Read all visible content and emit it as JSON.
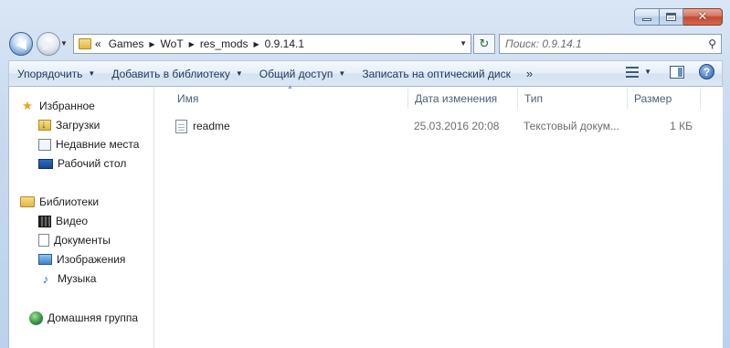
{
  "window": {
    "caption": {
      "minimize_icon": "minimize-icon",
      "maximize_icon": "maximize-icon",
      "close_icon": "close-icon",
      "close_glyph": "✕"
    }
  },
  "navigation": {
    "back_glyph": "◀",
    "forward_glyph": "▶",
    "breadcrumb_overflow": "«",
    "breadcrumb": [
      "Games",
      "WoT",
      "res_mods",
      "0.9.14.1"
    ],
    "breadcrumb_separator": "▶",
    "refresh_glyph": "↻",
    "search_placeholder": "Поиск: 0.9.14.1"
  },
  "commands": [
    {
      "label": "Упорядочить",
      "has_dropdown": true
    },
    {
      "label": "Добавить в библиотеку",
      "has_dropdown": true
    },
    {
      "label": "Общий доступ",
      "has_dropdown": true
    },
    {
      "label": "Записать на оптический диск",
      "has_dropdown": false
    }
  ],
  "commands_more": "»",
  "dropdown_glyph": "▼",
  "help_glyph": "?",
  "sidebar": {
    "favorites_label": "Избранное",
    "favorites": [
      "Загрузки",
      "Недавние места",
      "Рабочий стол"
    ],
    "libraries_label": "Библиотеки",
    "libraries": [
      "Видео",
      "Документы",
      "Изображения",
      "Музыка"
    ],
    "homegroup_label": "Домашняя группа"
  },
  "file_list": {
    "columns": [
      "Имя",
      "Дата изменения",
      "Тип",
      "Размер"
    ],
    "sort_glyph": "▲",
    "rows": [
      {
        "name": "readme",
        "modified": "25.03.2016 20:08",
        "type": "Текстовый докум...",
        "size": "1 КБ"
      }
    ]
  },
  "colors": {
    "accent": "#1e395b",
    "frame": "#c7d9ef",
    "close": "#c24a31"
  }
}
